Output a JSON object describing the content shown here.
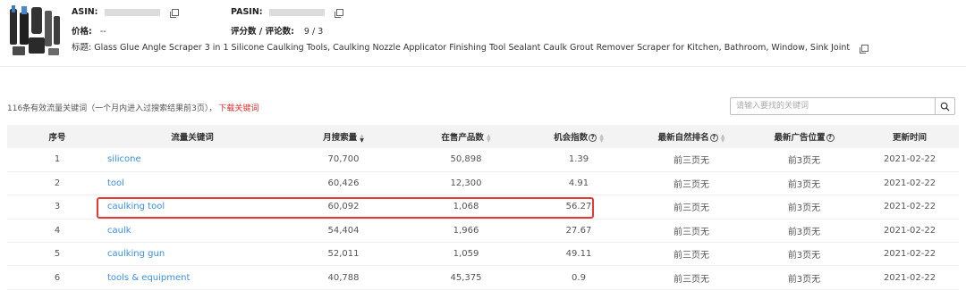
{
  "product": {
    "asin_label": "ASIN:",
    "pasin_label": "PASIN:",
    "price_label": "价格:",
    "price_value": "--",
    "rating_label": "评分数 / 评论数:",
    "rating_value": "9 / 3",
    "title_label": "标题:",
    "title_value": "Glass Glue Angle Scraper 3 in 1 Silicone Caulking Tools, Caulking Nozzle Applicator Finishing Tool Sealant Caulk Grout Remover Scraper for Kitchen, Bathroom, Window, Sink Joint"
  },
  "summary": {
    "text": "116条有效流量关键词（一个月内进入过搜索结果前3页），",
    "download_link": "下载关键词"
  },
  "search": {
    "placeholder": "请输入要找的关键词",
    "icon": "search-icon"
  },
  "table": {
    "headers": [
      "序号",
      "流量关键词",
      "月搜索量",
      "在售产品数",
      "机会指数",
      "最新自然排名",
      "最新广告位置",
      "更新时间"
    ],
    "rows": [
      {
        "idx": "1",
        "keyword": "silicone",
        "monthly": "70,700",
        "products": "50,898",
        "opportunity": "1.39",
        "organic": "前三页无",
        "ad": "前3页无",
        "updated": "2021-02-22"
      },
      {
        "idx": "2",
        "keyword": "tool",
        "monthly": "60,426",
        "products": "12,300",
        "opportunity": "4.91",
        "organic": "前三页无",
        "ad": "前3页无",
        "updated": "2021-02-22"
      },
      {
        "idx": "3",
        "keyword": "caulking tool",
        "monthly": "60,092",
        "products": "1,068",
        "opportunity": "56.27",
        "organic": "前三页无",
        "ad": "前3页无",
        "updated": "2021-02-22"
      },
      {
        "idx": "4",
        "keyword": "caulk",
        "monthly": "54,404",
        "products": "1,966",
        "opportunity": "27.67",
        "organic": "前三页无",
        "ad": "前3页无",
        "updated": "2021-02-22"
      },
      {
        "idx": "5",
        "keyword": "caulking gun",
        "monthly": "52,011",
        "products": "1,059",
        "opportunity": "49.11",
        "organic": "前三页无",
        "ad": "前3页无",
        "updated": "2021-02-22"
      },
      {
        "idx": "6",
        "keyword": "tools & equipment",
        "monthly": "40,788",
        "products": "45,375",
        "opportunity": "0.9",
        "organic": "前三页无",
        "ad": "前3页无",
        "updated": "2021-02-22"
      }
    ]
  },
  "colors": {
    "link": "#3a8ee6",
    "download": "#e02a2a",
    "highlight": "#e53935",
    "header_bg": "#f3f3f3"
  }
}
